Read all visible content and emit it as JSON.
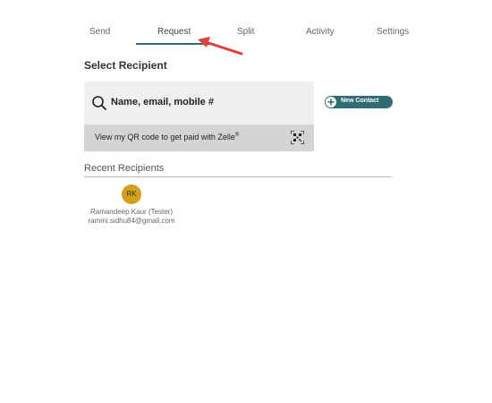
{
  "tabs": [
    {
      "label": "Send"
    },
    {
      "label": "Request"
    },
    {
      "label": "Split"
    },
    {
      "label": "Activity"
    },
    {
      "label": "Settings"
    }
  ],
  "active_tab": "Request",
  "section_title": "Select Recipient",
  "search": {
    "placeholder": "Name, email, mobile #",
    "value": ""
  },
  "qr": {
    "label": "View my QR code to get paid with Zelle",
    "trademark": "®"
  },
  "new_contact_label": "New Contact",
  "recent": {
    "heading": "Recent Recipients",
    "recipients": [
      {
        "initials": "RK",
        "name": "Ramandeep Kaur (Tester)",
        "email": "rammi.sidhu84@gmail.com"
      }
    ]
  },
  "colors": {
    "accent": "#2e6e73",
    "annotation_arrow": "#e0403a",
    "avatar": "#d4a017",
    "search_bg": "#efefef",
    "qr_bar_bg": "#d4d4d4"
  },
  "icons": {
    "search": "search-icon",
    "qr": "qr-code-icon",
    "plus": "plus-circle-icon",
    "annotation": "annotation-arrow-icon"
  }
}
